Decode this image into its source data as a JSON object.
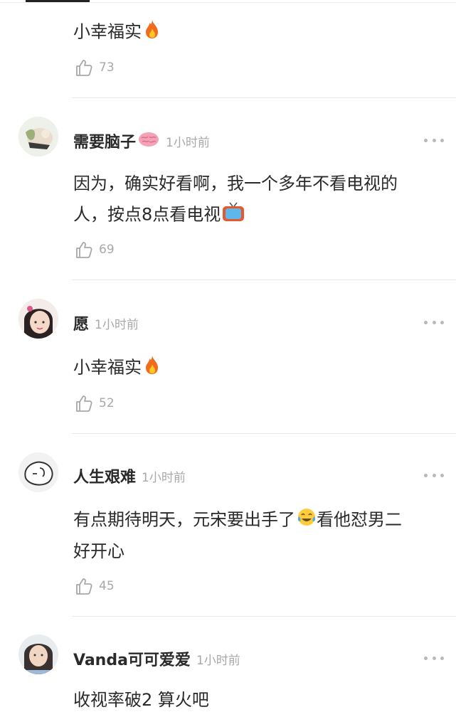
{
  "comments": [
    {
      "username": "",
      "time": "",
      "text": "小幸福实",
      "text_emoji": "fire",
      "likes": "73"
    },
    {
      "username": "需要脑子",
      "name_emoji": "brain",
      "time": "1小时前",
      "text_line1": "因为，确实好看啊，我一个多年不看电视的",
      "text_line2": "人，按点8点看电视",
      "text_emoji": "television",
      "likes": "69"
    },
    {
      "username": "愿",
      "time": "1小时前",
      "text": "小幸福实",
      "text_emoji": "fire",
      "likes": "52"
    },
    {
      "username": "人生艰难",
      "time": "1小时前",
      "text_line1_a": "有点期待明天，元宋要出手了",
      "text_line1_b": "看他怼男二",
      "text_line2": "好开心",
      "text_emoji": "tears-of-joy",
      "likes": "45"
    },
    {
      "username": "Vanda可可爱爱",
      "time": "1小时前",
      "text": "收视率破2 算火吧"
    }
  ],
  "icons": {
    "like": "thumbs-up-outline-icon",
    "more": "more-dots-icon"
  },
  "colors": {
    "text": "#2a2a2a",
    "muted": "#a8a8a8",
    "divider": "#e8e8e8",
    "dots": "#b8b8b8"
  }
}
